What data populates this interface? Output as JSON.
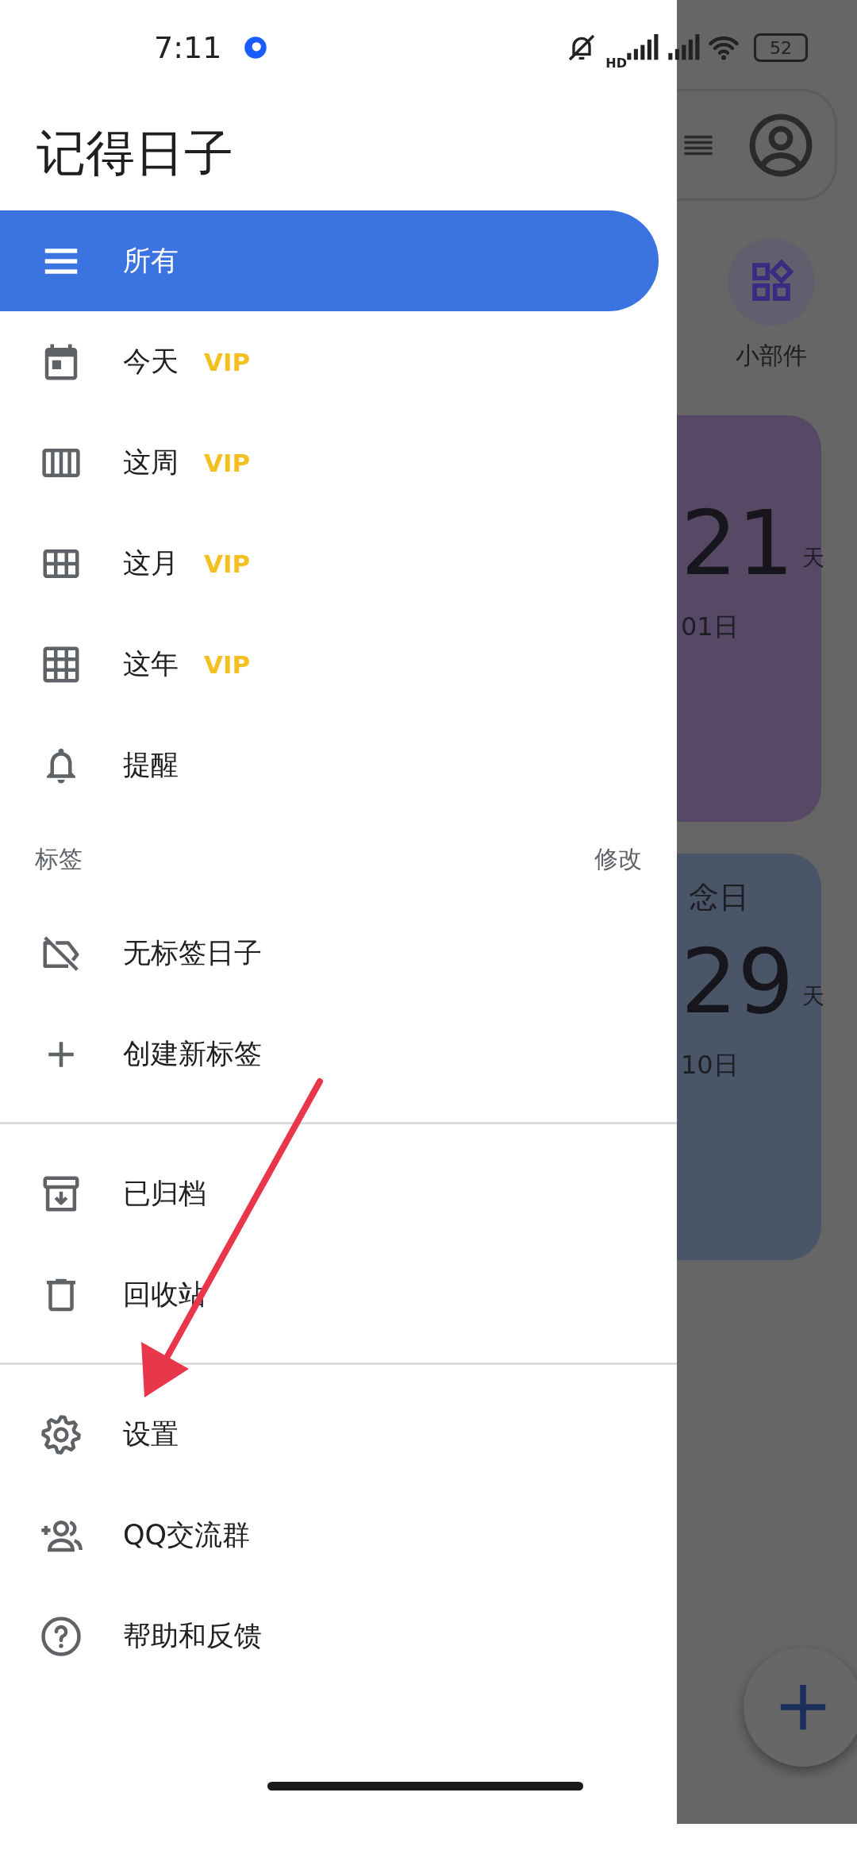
{
  "status_bar": {
    "time": "7:11",
    "network": "HD",
    "battery": "52"
  },
  "drawer": {
    "title": "记得日子",
    "main_items": [
      {
        "label": "所有",
        "selected": true
      },
      {
        "label": "今天",
        "badge": "VIP",
        "selected": false
      },
      {
        "label": "这周",
        "badge": "VIP",
        "selected": false
      },
      {
        "label": "这月",
        "badge": "VIP",
        "selected": false
      },
      {
        "label": "这年",
        "badge": "VIP",
        "selected": false
      },
      {
        "label": "提醒",
        "selected": false
      }
    ],
    "tags_section": {
      "title": "标签",
      "action": "修改",
      "items": [
        {
          "label": "无标签日子",
          "selected": false
        },
        {
          "label": "创建新标签",
          "selected": false
        }
      ]
    },
    "archive_items": [
      {
        "label": "已归档",
        "selected": false
      },
      {
        "label": "回收站",
        "selected": false
      }
    ],
    "footer_items": [
      {
        "label": "设置",
        "selected": false
      },
      {
        "label": "QQ交流群",
        "selected": false
      },
      {
        "label": "帮助和反馈",
        "selected": false
      }
    ]
  },
  "background": {
    "widget_label": "小部件",
    "cards": [
      {
        "number": "21",
        "unit": "天",
        "date": "01日",
        "color": "#574865"
      },
      {
        "title": "念日",
        "number": "29",
        "unit": "天",
        "date": "10日",
        "color": "#4a5568"
      }
    ]
  }
}
